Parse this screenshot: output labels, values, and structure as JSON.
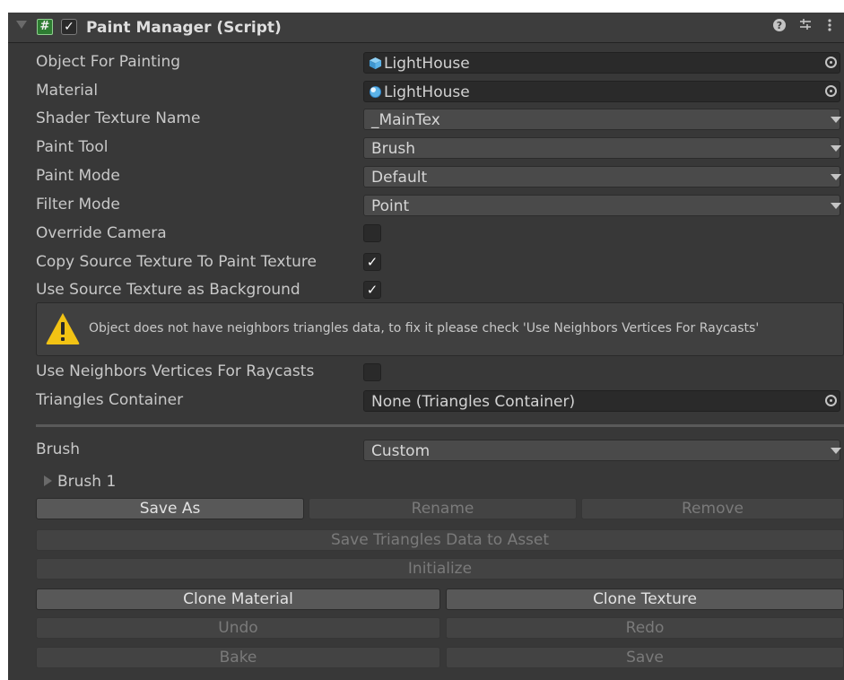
{
  "header": {
    "title": "Paint Manager (Script)",
    "enabled": true,
    "icons": [
      "help-icon",
      "presets-icon",
      "more-icon"
    ]
  },
  "fields": {
    "object_for_painting": {
      "label": "Object For Painting",
      "value": "LightHouse",
      "icon": "prefab-cube-icon"
    },
    "material": {
      "label": "Material",
      "value": "LightHouse",
      "icon": "material-sphere-icon"
    },
    "shader_texture_name": {
      "label": "Shader Texture Name",
      "value": "_MainTex"
    },
    "paint_tool": {
      "label": "Paint Tool",
      "value": "Brush"
    },
    "paint_mode": {
      "label": "Paint Mode",
      "value": "Default"
    },
    "filter_mode": {
      "label": "Filter Mode",
      "value": "Point"
    },
    "override_camera": {
      "label": "Override Camera",
      "checked": false
    },
    "copy_source_texture": {
      "label": "Copy Source Texture To Paint Texture",
      "checked": true
    },
    "use_source_texture_bg": {
      "label": "Use Source Texture as Background",
      "checked": true
    },
    "warning": "Object does not have neighbors triangles data, to fix it please check 'Use Neighbors Vertices For Raycasts'",
    "use_neighbors_vertices": {
      "label": "Use Neighbors Vertices For Raycasts",
      "checked": false
    },
    "triangles_container": {
      "label": "Triangles Container",
      "value": "None (Triangles Container)"
    },
    "brush": {
      "label": "Brush",
      "value": "Custom"
    },
    "brush_foldout": "Brush 1"
  },
  "buttons": {
    "save_as": "Save As",
    "rename": "Rename",
    "remove": "Remove",
    "save_triangles": "Save Triangles Data to Asset",
    "initialize": "Initialize",
    "clone_material": "Clone Material",
    "clone_texture": "Clone Texture",
    "undo": "Undo",
    "redo": "Redo",
    "bake": "Bake",
    "save": "Save"
  },
  "colors": {
    "panel_bg": "#383838",
    "header_bg": "#3d3d3d",
    "field_bg": "#2a2a2a",
    "button_bg": "#585858",
    "button_disabled_bg": "#434343",
    "warning_yellow": "#f2c314",
    "prefab_blue": "#5cb3e8"
  }
}
